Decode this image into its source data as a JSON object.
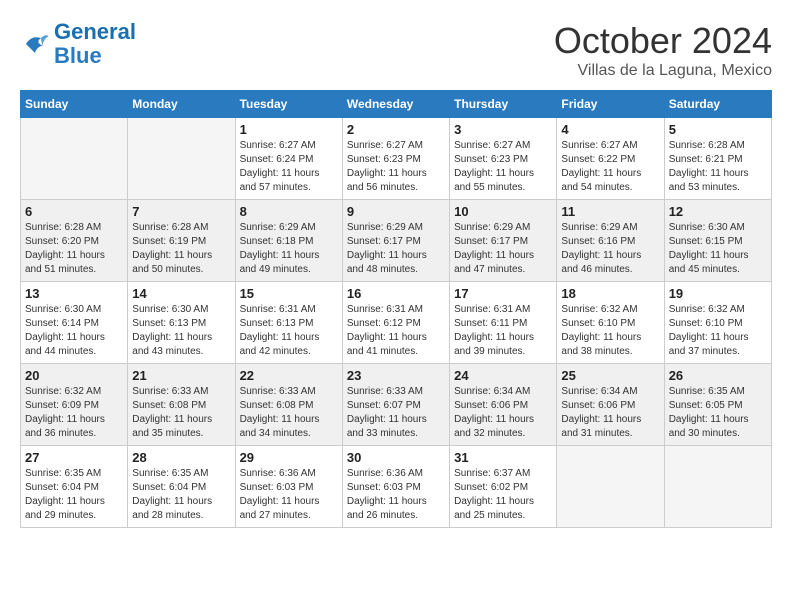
{
  "logo": {
    "line1": "General",
    "line2": "Blue"
  },
  "title": "October 2024",
  "subtitle": "Villas de la Laguna, Mexico",
  "days_of_week": [
    "Sunday",
    "Monday",
    "Tuesday",
    "Wednesday",
    "Thursday",
    "Friday",
    "Saturday"
  ],
  "weeks": [
    [
      {
        "day": "",
        "sunrise": "",
        "sunset": "",
        "daylight": "",
        "empty": true
      },
      {
        "day": "",
        "sunrise": "",
        "sunset": "",
        "daylight": "",
        "empty": true
      },
      {
        "day": "1",
        "sunrise": "Sunrise: 6:27 AM",
        "sunset": "Sunset: 6:24 PM",
        "daylight": "Daylight: 11 hours and 57 minutes."
      },
      {
        "day": "2",
        "sunrise": "Sunrise: 6:27 AM",
        "sunset": "Sunset: 6:23 PM",
        "daylight": "Daylight: 11 hours and 56 minutes."
      },
      {
        "day": "3",
        "sunrise": "Sunrise: 6:27 AM",
        "sunset": "Sunset: 6:23 PM",
        "daylight": "Daylight: 11 hours and 55 minutes."
      },
      {
        "day": "4",
        "sunrise": "Sunrise: 6:27 AM",
        "sunset": "Sunset: 6:22 PM",
        "daylight": "Daylight: 11 hours and 54 minutes."
      },
      {
        "day": "5",
        "sunrise": "Sunrise: 6:28 AM",
        "sunset": "Sunset: 6:21 PM",
        "daylight": "Daylight: 11 hours and 53 minutes."
      }
    ],
    [
      {
        "day": "6",
        "sunrise": "Sunrise: 6:28 AM",
        "sunset": "Sunset: 6:20 PM",
        "daylight": "Daylight: 11 hours and 51 minutes."
      },
      {
        "day": "7",
        "sunrise": "Sunrise: 6:28 AM",
        "sunset": "Sunset: 6:19 PM",
        "daylight": "Daylight: 11 hours and 50 minutes."
      },
      {
        "day": "8",
        "sunrise": "Sunrise: 6:29 AM",
        "sunset": "Sunset: 6:18 PM",
        "daylight": "Daylight: 11 hours and 49 minutes."
      },
      {
        "day": "9",
        "sunrise": "Sunrise: 6:29 AM",
        "sunset": "Sunset: 6:17 PM",
        "daylight": "Daylight: 11 hours and 48 minutes."
      },
      {
        "day": "10",
        "sunrise": "Sunrise: 6:29 AM",
        "sunset": "Sunset: 6:17 PM",
        "daylight": "Daylight: 11 hours and 47 minutes."
      },
      {
        "day": "11",
        "sunrise": "Sunrise: 6:29 AM",
        "sunset": "Sunset: 6:16 PM",
        "daylight": "Daylight: 11 hours and 46 minutes."
      },
      {
        "day": "12",
        "sunrise": "Sunrise: 6:30 AM",
        "sunset": "Sunset: 6:15 PM",
        "daylight": "Daylight: 11 hours and 45 minutes."
      }
    ],
    [
      {
        "day": "13",
        "sunrise": "Sunrise: 6:30 AM",
        "sunset": "Sunset: 6:14 PM",
        "daylight": "Daylight: 11 hours and 44 minutes."
      },
      {
        "day": "14",
        "sunrise": "Sunrise: 6:30 AM",
        "sunset": "Sunset: 6:13 PM",
        "daylight": "Daylight: 11 hours and 43 minutes."
      },
      {
        "day": "15",
        "sunrise": "Sunrise: 6:31 AM",
        "sunset": "Sunset: 6:13 PM",
        "daylight": "Daylight: 11 hours and 42 minutes."
      },
      {
        "day": "16",
        "sunrise": "Sunrise: 6:31 AM",
        "sunset": "Sunset: 6:12 PM",
        "daylight": "Daylight: 11 hours and 41 minutes."
      },
      {
        "day": "17",
        "sunrise": "Sunrise: 6:31 AM",
        "sunset": "Sunset: 6:11 PM",
        "daylight": "Daylight: 11 hours and 39 minutes."
      },
      {
        "day": "18",
        "sunrise": "Sunrise: 6:32 AM",
        "sunset": "Sunset: 6:10 PM",
        "daylight": "Daylight: 11 hours and 38 minutes."
      },
      {
        "day": "19",
        "sunrise": "Sunrise: 6:32 AM",
        "sunset": "Sunset: 6:10 PM",
        "daylight": "Daylight: 11 hours and 37 minutes."
      }
    ],
    [
      {
        "day": "20",
        "sunrise": "Sunrise: 6:32 AM",
        "sunset": "Sunset: 6:09 PM",
        "daylight": "Daylight: 11 hours and 36 minutes."
      },
      {
        "day": "21",
        "sunrise": "Sunrise: 6:33 AM",
        "sunset": "Sunset: 6:08 PM",
        "daylight": "Daylight: 11 hours and 35 minutes."
      },
      {
        "day": "22",
        "sunrise": "Sunrise: 6:33 AM",
        "sunset": "Sunset: 6:08 PM",
        "daylight": "Daylight: 11 hours and 34 minutes."
      },
      {
        "day": "23",
        "sunrise": "Sunrise: 6:33 AM",
        "sunset": "Sunset: 6:07 PM",
        "daylight": "Daylight: 11 hours and 33 minutes."
      },
      {
        "day": "24",
        "sunrise": "Sunrise: 6:34 AM",
        "sunset": "Sunset: 6:06 PM",
        "daylight": "Daylight: 11 hours and 32 minutes."
      },
      {
        "day": "25",
        "sunrise": "Sunrise: 6:34 AM",
        "sunset": "Sunset: 6:06 PM",
        "daylight": "Daylight: 11 hours and 31 minutes."
      },
      {
        "day": "26",
        "sunrise": "Sunrise: 6:35 AM",
        "sunset": "Sunset: 6:05 PM",
        "daylight": "Daylight: 11 hours and 30 minutes."
      }
    ],
    [
      {
        "day": "27",
        "sunrise": "Sunrise: 6:35 AM",
        "sunset": "Sunset: 6:04 PM",
        "daylight": "Daylight: 11 hours and 29 minutes."
      },
      {
        "day": "28",
        "sunrise": "Sunrise: 6:35 AM",
        "sunset": "Sunset: 6:04 PM",
        "daylight": "Daylight: 11 hours and 28 minutes."
      },
      {
        "day": "29",
        "sunrise": "Sunrise: 6:36 AM",
        "sunset": "Sunset: 6:03 PM",
        "daylight": "Daylight: 11 hours and 27 minutes."
      },
      {
        "day": "30",
        "sunrise": "Sunrise: 6:36 AM",
        "sunset": "Sunset: 6:03 PM",
        "daylight": "Daylight: 11 hours and 26 minutes."
      },
      {
        "day": "31",
        "sunrise": "Sunrise: 6:37 AM",
        "sunset": "Sunset: 6:02 PM",
        "daylight": "Daylight: 11 hours and 25 minutes."
      },
      {
        "day": "",
        "sunrise": "",
        "sunset": "",
        "daylight": "",
        "empty": true
      },
      {
        "day": "",
        "sunrise": "",
        "sunset": "",
        "daylight": "",
        "empty": true
      }
    ]
  ]
}
